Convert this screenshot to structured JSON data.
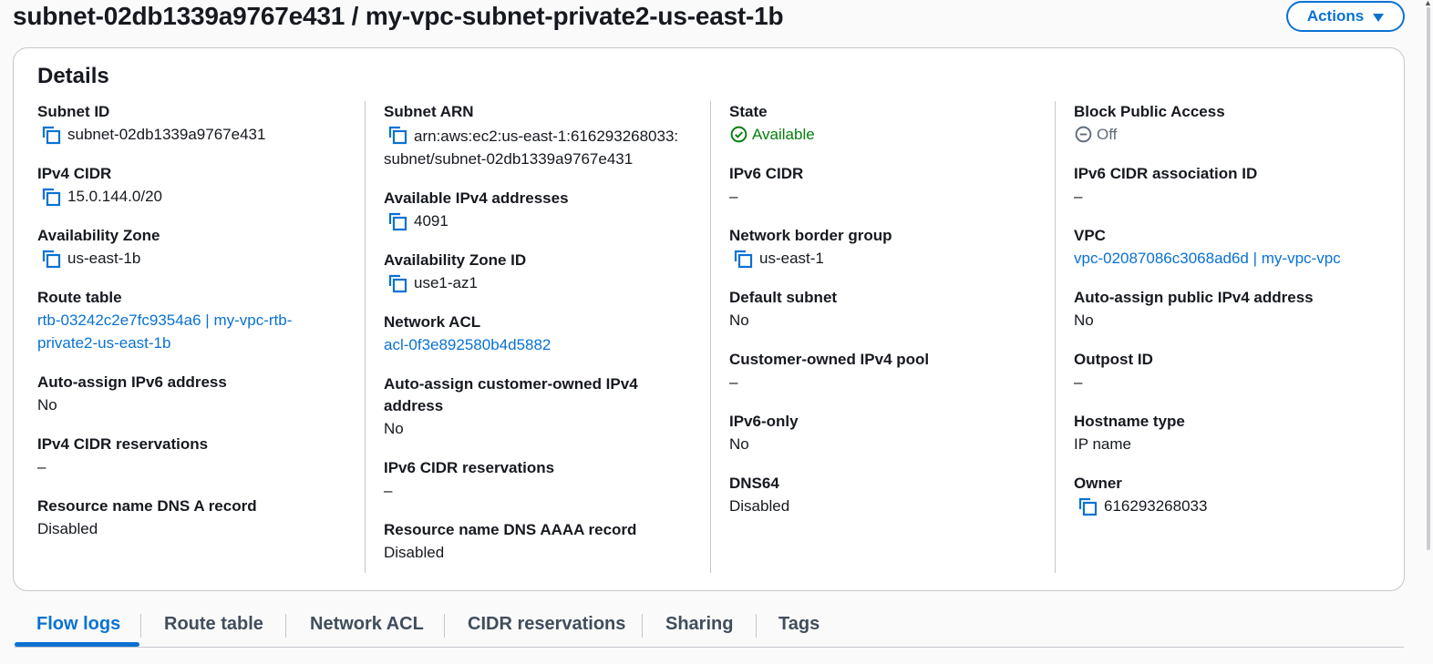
{
  "page": {
    "title": "subnet-02db1339a9767e431 / my-vpc-subnet-private2-us-east-1b",
    "actions_label": "Actions"
  },
  "details": {
    "title": "Details",
    "col1": {
      "subnet_id": {
        "label": "Subnet ID",
        "value": "subnet-02db1339a9767e431"
      },
      "ipv4_cidr": {
        "label": "IPv4 CIDR",
        "value": "15.0.144.0/20"
      },
      "availability_zone": {
        "label": "Availability Zone",
        "value": "us-east-1b"
      },
      "route_table": {
        "label": "Route table",
        "value_line1": "rtb-03242c2e7fc9354a6 | my-vpc-rtb-",
        "value_line2": "private2-us-east-1b"
      },
      "auto_assign_ipv6": {
        "label": "Auto-assign IPv6 address",
        "value": "No"
      },
      "ipv4_cidr_reservations": {
        "label": "IPv4 CIDR reservations",
        "value": "–"
      },
      "resource_name_dns_a": {
        "label": "Resource name DNS A record",
        "value": "Disabled"
      }
    },
    "col2": {
      "subnet_arn": {
        "label": "Subnet ARN",
        "value_line1": "arn:aws:ec2:us-east-1:616293268033:",
        "value_line2": "subnet/subnet-02db1339a9767e431"
      },
      "available_ipv4": {
        "label": "Available IPv4 addresses",
        "value": "4091"
      },
      "availability_zone_id": {
        "label": "Availability Zone ID",
        "value": "use1-az1"
      },
      "network_acl": {
        "label": "Network ACL",
        "value": "acl-0f3e892580b4d5882"
      },
      "auto_assign_customer_owned": {
        "label_line1": "Auto-assign customer-owned IPv4",
        "label_line2": "address",
        "value": "No"
      },
      "ipv6_cidr_reservations": {
        "label": "IPv6 CIDR reservations",
        "value": "–"
      },
      "resource_name_dns_aaaa": {
        "label": "Resource name DNS AAAA record",
        "value": "Disabled"
      }
    },
    "col3": {
      "state": {
        "label": "State",
        "value": "Available"
      },
      "ipv6_cidr": {
        "label": "IPv6 CIDR",
        "value": "–"
      },
      "network_border_group": {
        "label": "Network border group",
        "value": "us-east-1"
      },
      "default_subnet": {
        "label": "Default subnet",
        "value": "No"
      },
      "customer_owned_pool": {
        "label": "Customer-owned IPv4 pool",
        "value": "–"
      },
      "ipv6_only": {
        "label": "IPv6-only",
        "value": "No"
      },
      "dns64": {
        "label": "DNS64",
        "value": "Disabled"
      }
    },
    "col4": {
      "block_public_access": {
        "label": "Block Public Access",
        "value": "Off"
      },
      "ipv6_cidr_association_id": {
        "label": "IPv6 CIDR association ID",
        "value": "–"
      },
      "vpc": {
        "label": "VPC",
        "value": "vpc-02087086c3068ad6d | my-vpc-vpc"
      },
      "auto_assign_public_ipv4": {
        "label": "Auto-assign public IPv4 address",
        "value": "No"
      },
      "outpost_id": {
        "label": "Outpost ID",
        "value": "–"
      },
      "hostname_type": {
        "label": "Hostname type",
        "value": "IP name"
      },
      "owner": {
        "label": "Owner",
        "value": "616293268033"
      }
    }
  },
  "tabs": [
    {
      "label": "Flow logs",
      "active": true
    },
    {
      "label": "Route table"
    },
    {
      "label": "Network ACL"
    },
    {
      "label": "CIDR reservations"
    },
    {
      "label": "Sharing"
    },
    {
      "label": "Tags"
    }
  ],
  "colors": {
    "link": "#0972d3",
    "available": "#037f0c",
    "off": "#5f6b7a",
    "border": "#c6c6cd"
  },
  "icons": [
    "copy-icon",
    "check-circle-icon",
    "minus-circle-icon",
    "caret-down-icon"
  ]
}
